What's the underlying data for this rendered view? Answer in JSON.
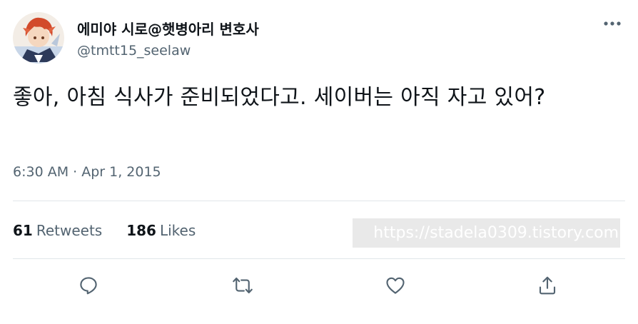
{
  "tweet": {
    "author": {
      "display_name": "에미야 시로@햇병아리 변호사",
      "handle": "@tmtt15_seelaw"
    },
    "text": "좋아, 아침 식사가 준비되었다고. 세이버는 아직 자고 있어?",
    "timestamp": "6:30 AM · Apr 1, 2015",
    "stats": {
      "retweets_count": "61",
      "retweets_label": "Retweets",
      "likes_count": "186",
      "likes_label": "Likes"
    },
    "watermark": "https://stadela0309.tistory.com",
    "actions": [
      "reply-icon",
      "retweet-icon",
      "like-icon",
      "share-icon"
    ],
    "colors": {
      "text_primary": "#0f1419",
      "text_secondary": "#536471",
      "divider": "#e1e6ea",
      "icon": "#536471"
    }
  }
}
